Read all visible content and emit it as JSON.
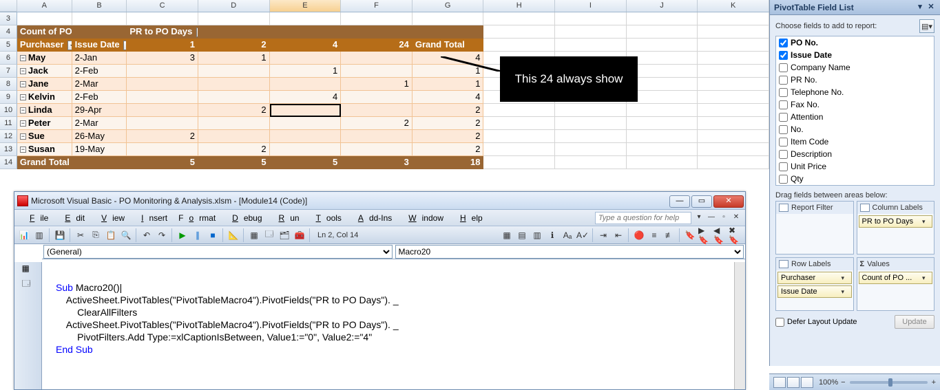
{
  "columns": [
    "A",
    "B",
    "C",
    "D",
    "E",
    "F",
    "G",
    "H",
    "I",
    "J",
    "K"
  ],
  "pivot": {
    "header_measure": "Count of PO No.",
    "header_col_field": "PR to PO Days",
    "row_field1": "Purchaser",
    "row_field2": "Issue Date",
    "col_values": [
      "1",
      "2",
      "4",
      "24"
    ],
    "gt_label": "Grand Total",
    "rows": [
      {
        "name": "May",
        "date": "2-Jan",
        "v": [
          "3",
          "1",
          "",
          "",
          ""
        ],
        "gt": "4"
      },
      {
        "name": "Jack",
        "date": "2-Feb",
        "v": [
          "",
          "",
          "1",
          "",
          ""
        ],
        "gt": "1"
      },
      {
        "name": "Jane",
        "date": "2-Mar",
        "v": [
          "",
          "",
          "",
          "1",
          ""
        ],
        "gt": "1"
      },
      {
        "name": "Kelvin",
        "date": "2-Feb",
        "v": [
          "",
          "",
          "4",
          "",
          ""
        ],
        "gt": "4"
      },
      {
        "name": "Linda",
        "date": "29-Apr",
        "v": [
          "",
          "2",
          "",
          "",
          ""
        ],
        "gt": "2"
      },
      {
        "name": "Peter",
        "date": "2-Mar",
        "v": [
          "",
          "",
          "",
          "2",
          ""
        ],
        "gt": "2"
      },
      {
        "name": "Sue",
        "date": "26-May",
        "v": [
          "2",
          "",
          "",
          "",
          ""
        ],
        "gt": "2"
      },
      {
        "name": "Susan",
        "date": "19-May",
        "v": [
          "",
          "2",
          "",
          "",
          ""
        ],
        "gt": "2"
      }
    ],
    "totals": [
      "5",
      "5",
      "5",
      "3"
    ],
    "grand": "18"
  },
  "callout": "This 24 always show",
  "vbe": {
    "title": "Microsoft Visual Basic - PO Monitoring & Analysis.xlsm - [Module14 (Code)]",
    "menus": [
      "File",
      "Edit",
      "View",
      "Insert",
      "Format",
      "Debug",
      "Run",
      "Tools",
      "Add-Ins",
      "Window",
      "Help"
    ],
    "help_placeholder": "Type a question for help",
    "status": "Ln 2, Col 14",
    "dd_left": "(General)",
    "dd_right": "Macro20",
    "code_lines": [
      {
        "t": "Sub ",
        "kw": true,
        "rest": "Macro20()"
      },
      {
        "t": "    ActiveSheet.PivotTables(\"PivotTableMacro4\").PivotFields(\"PR to PO Days\"). _"
      },
      {
        "t": "        ClearAllFilters"
      },
      {
        "t": "    ActiveSheet.PivotTables(\"PivotTableMacro4\").PivotFields(\"PR to PO Days\"). _"
      },
      {
        "t": "        PivotFilters.Add Type:=xlCaptionIsBetween, Value1:=\"0\", Value2:=\"4\""
      },
      {
        "t": "End Sub",
        "kw": true
      }
    ]
  },
  "panel": {
    "title": "PivotTable Field List",
    "choose_label": "Choose fields to add to report:",
    "fields": [
      {
        "label": "PO No.",
        "checked": true,
        "bold": true
      },
      {
        "label": "Issue Date",
        "checked": true,
        "bold": true
      },
      {
        "label": "Company Name",
        "checked": false
      },
      {
        "label": "PR No.",
        "checked": false
      },
      {
        "label": "Telephone No.",
        "checked": false
      },
      {
        "label": "Fax No.",
        "checked": false
      },
      {
        "label": "Attention",
        "checked": false
      },
      {
        "label": "No.",
        "checked": false
      },
      {
        "label": "Item  Code",
        "checked": false
      },
      {
        "label": "Description",
        "checked": false
      },
      {
        "label": "Unit Price",
        "checked": false
      },
      {
        "label": "Qty",
        "checked": false
      }
    ],
    "drag_label": "Drag fields between areas below:",
    "zone_report": "Report Filter",
    "zone_column": "Column Labels",
    "zone_row": "Row Labels",
    "zone_values": "Values",
    "col_chips": [
      "PR to PO Days"
    ],
    "row_chips": [
      "Purchaser",
      "Issue Date"
    ],
    "val_chips": [
      "Count of PO ..."
    ],
    "defer_label": "Defer Layout Update",
    "update_btn": "Update"
  },
  "status": {
    "zoom": "100%"
  }
}
